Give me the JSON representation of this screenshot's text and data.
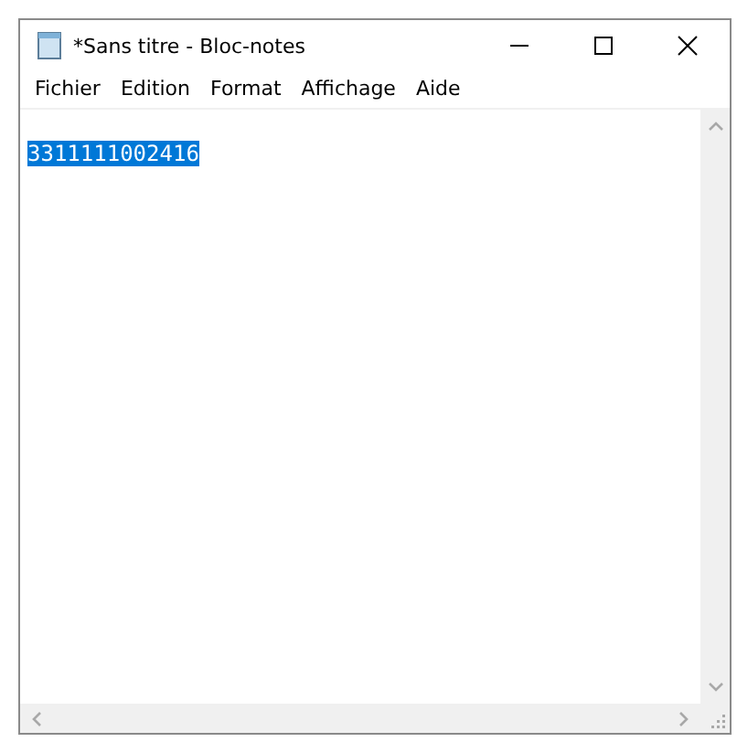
{
  "window": {
    "title": "*Sans titre - Bloc-notes"
  },
  "menu": [
    "Fichier",
    "Edition",
    "Format",
    "Affichage",
    "Aide"
  ],
  "editor": {
    "text": "3311111002416",
    "selected": true
  }
}
